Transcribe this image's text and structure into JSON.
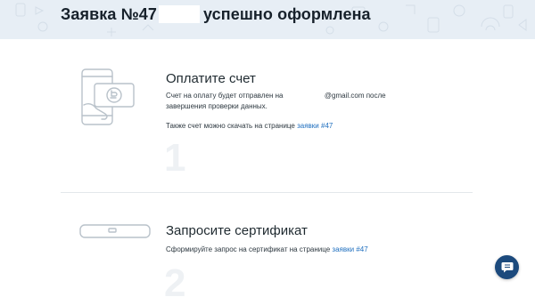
{
  "page": {
    "title_part1": "Заявка №47",
    "title_part2": "успешно оформлена"
  },
  "step1": {
    "title": "Оплатите счет",
    "text_prefix": "Счет на оплату будет отправлен на",
    "text_email": "@gmail.com после",
    "text_line2": "завершения проверки данных.",
    "download_prefix": "Также счет можно скачать на странице",
    "download_link": "заявки #47",
    "number": "1",
    "illustration_icon": "phone-payment-icon"
  },
  "step2": {
    "title": "Запросите сертификат",
    "text_prefix": "Сформируйте запрос на сертификат на странице",
    "request_link": "заявки #47",
    "number": "2",
    "illustration_icon": "usb-token-icon"
  },
  "chat": {
    "icon": "chat-icon",
    "color": "#1c4a7d"
  },
  "colors": {
    "header_bg": "#e7eef5",
    "link": "#1f6fbf"
  }
}
